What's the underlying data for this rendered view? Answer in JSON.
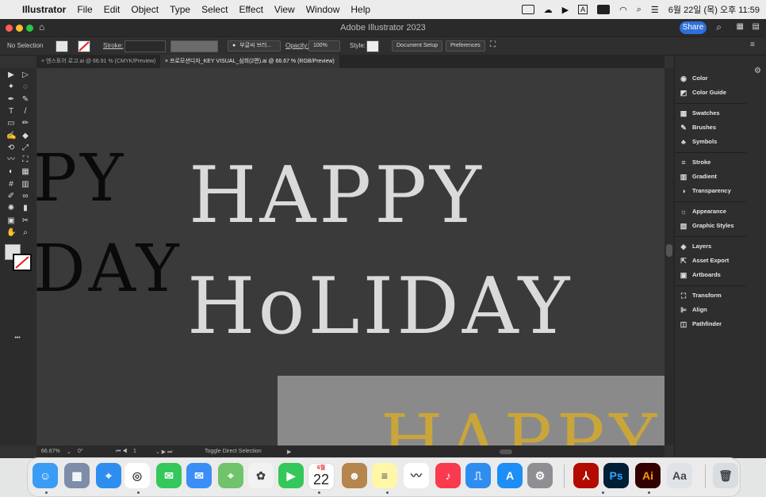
{
  "menubar": {
    "apple": "",
    "app": "Illustrator",
    "items": [
      "File",
      "Edit",
      "Object",
      "Type",
      "Select",
      "Effect",
      "View",
      "Window",
      "Help"
    ],
    "clock": "6월 22일 (목) 오후 11:59",
    "input_indicator": "A"
  },
  "window": {
    "title": "Adobe Illustrator 2023",
    "share_label": "Share"
  },
  "control_bar": {
    "selection": "No Selection",
    "stroke_label": "Stroke:",
    "brush_label": "부글씨 브러...",
    "opacity_label": "Opacity:",
    "opacity_value": "100%",
    "style_label": "Style:",
    "document_setup": "Document Setup",
    "preferences": "Preferences"
  },
  "tabs": [
    {
      "label": "엔스토어 로고.ai @ 66.91 % (CMYK/Preview)"
    },
    {
      "label": "프로모션디자_KEY VISUAL_심희(2편).ai @ 66.67 % (RGB/Preview)"
    }
  ],
  "canvas": {
    "left_fragment_line1": "PY",
    "left_fragment_line2": "DAY",
    "main_line1": "HAPPY",
    "main_line2": "HoLIDAY",
    "gold_text": "HAPPY"
  },
  "status": {
    "zoom": "66.67%",
    "rotation": "0°",
    "artboard": "1",
    "hint": "Toggle Direct Selection"
  },
  "panels": [
    {
      "label": "Color",
      "icon": "color-icon"
    },
    {
      "label": "Color Guide",
      "icon": "color-guide-icon"
    },
    {
      "label": "Swatches",
      "icon": "swatches-icon"
    },
    {
      "label": "Brushes",
      "icon": "brushes-icon"
    },
    {
      "label": "Symbols",
      "icon": "symbols-icon"
    },
    {
      "label": "Stroke",
      "icon": "stroke-icon"
    },
    {
      "label": "Gradient",
      "icon": "gradient-icon"
    },
    {
      "label": "Transparency",
      "icon": "transparency-icon"
    },
    {
      "label": "Appearance",
      "icon": "appearance-icon"
    },
    {
      "label": "Graphic Styles",
      "icon": "graphic-styles-icon"
    },
    {
      "label": "Layers",
      "icon": "layers-icon"
    },
    {
      "label": "Asset Export",
      "icon": "asset-export-icon"
    },
    {
      "label": "Artboards",
      "icon": "artboards-icon"
    },
    {
      "label": "Transform",
      "icon": "transform-icon"
    },
    {
      "label": "Align",
      "icon": "align-icon"
    },
    {
      "label": "Pathfinder",
      "icon": "pathfinder-icon"
    }
  ],
  "dock": {
    "calendar_month": "6월",
    "calendar_day": "22",
    "apps": [
      "Finder",
      "Launchpad",
      "Safari",
      "Chrome",
      "Messages",
      "Mail",
      "Maps",
      "Photos",
      "FaceTime",
      "Calendar",
      "Contacts",
      "Notes",
      "Freeform",
      "Music",
      "Keynote",
      "App Store",
      "System Settings",
      "Acrobat",
      "Photoshop",
      "Illustrator",
      "Font Book",
      "Trash"
    ],
    "ps_label": "Ps",
    "ai_label": "Ai"
  },
  "colors": {
    "canvas": "#3a3a3a",
    "share": "#2f6fdb",
    "gold": "#c9a53a",
    "text_light": "#dadada"
  }
}
